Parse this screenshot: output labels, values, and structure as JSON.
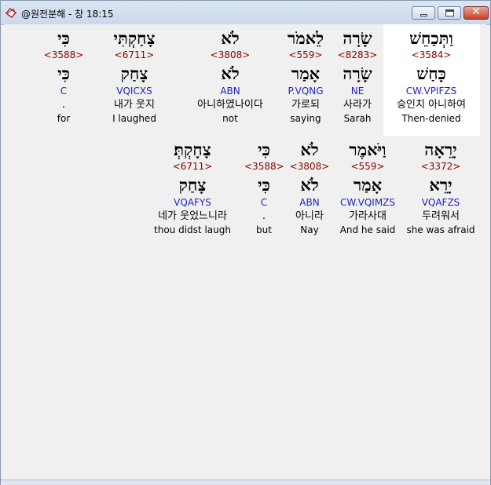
{
  "window": {
    "title": "@원전분해 - 창 18:15",
    "close_glyph": "✕"
  },
  "rows": [
    [
      {
        "hebrew": "וַתְּכַחֵשׁ",
        "strong": "<3584>",
        "lemma": "כָּחַשׁ",
        "morph": "CW.VPIFZS",
        "korean": "승인치 아니하여",
        "english": "Then-denied"
      },
      {
        "hebrew": "שָׂרָה",
        "strong": "<8283>",
        "lemma": "שָׂרָה",
        "morph": "NE",
        "korean": "사라가",
        "english": "Sarah"
      },
      {
        "hebrew": "לֵאמֹר",
        "strong": "<559>",
        "lemma": "אָמַר",
        "morph": "P.VQNG",
        "korean": "가로되",
        "english": "saying"
      },
      {
        "hebrew": "לֹא",
        "strong": "<3808>",
        "lemma": "לֹא",
        "morph": "ABN",
        "korean": "아니하였나이다",
        "english": "not"
      },
      {
        "hebrew": "צָחַקְתִּי",
        "strong": "<6711>",
        "lemma": "צָחַק",
        "morph": "VQICXS",
        "korean": "내가 웃지",
        "english": "I laughed"
      },
      {
        "hebrew": "כִּי",
        "strong": "<3588>",
        "lemma": "כִּי",
        "morph": "C",
        "korean": ".",
        "english": "for"
      }
    ],
    [
      {
        "hebrew": "יָרֵאָה",
        "strong": "<3372>",
        "lemma": "יָרֵא",
        "morph": "VQAFZS",
        "korean": "두려워서",
        "english": "she was afraid"
      },
      {
        "hebrew": "וַיֹּאמֶר",
        "strong": "<559>",
        "lemma": "אָמַר",
        "morph": "CW.VQIMZS",
        "korean": "가라사대",
        "english": "And he said"
      },
      {
        "hebrew": "לֹא",
        "strong": "<3808>",
        "lemma": "לֹא",
        "morph": "ABN",
        "korean": "아니라",
        "english": "Nay"
      },
      {
        "hebrew": "כִּי",
        "strong": "<3588>",
        "lemma": "כִּי",
        "morph": "C",
        "korean": ".",
        "english": "but"
      },
      {
        "hebrew": "צָחָקְתְּ׃",
        "strong": "<6711>",
        "lemma": "צָחַק",
        "morph": "VQAFYS",
        "korean": "네가 웃었느니라",
        "english": "thou didst laugh"
      }
    ]
  ]
}
